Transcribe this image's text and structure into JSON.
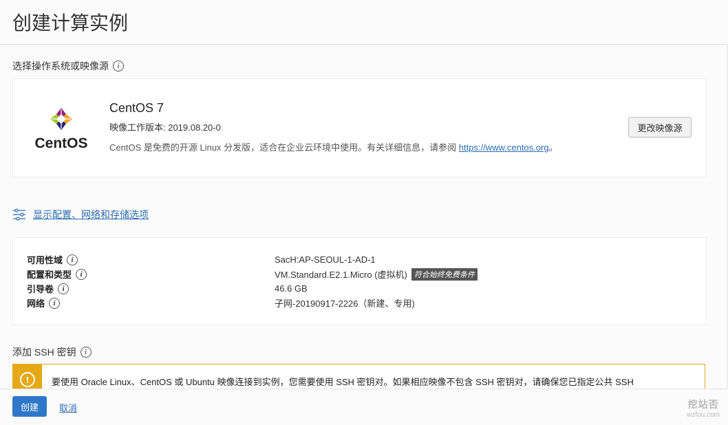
{
  "page": {
    "title": "创建计算实例"
  },
  "image_section": {
    "label": "选择操作系统或映像源",
    "info_glyph": "i",
    "os": {
      "logo_text": "CentOS",
      "name": "CentOS 7",
      "version_label": "映像工作版本: 2019.08.20-0",
      "description_prefix": "CentOS 是免费的开源 Linux 分发版，适合在企业云环境中使用。有关详细信息，请参阅 ",
      "link_text": "https://www.centos.org",
      "description_suffix": "。",
      "logo_colors": [
        "#9ccd2a",
        "#932279",
        "#efa724",
        "#262577"
      ]
    },
    "change_button": "更改映像源"
  },
  "advanced_link": "显示配置、网络和存储选项",
  "summary": {
    "rows": [
      {
        "key": "可用性域",
        "value": "SacH:AP-SEOUL-1-AD-1"
      },
      {
        "key": "配置和类型",
        "value": "VM.Standard.E2.1.Micro (虚拟机)",
        "badge": "符合始终免费条件"
      },
      {
        "key": "引导卷",
        "value": "46.6 GB"
      },
      {
        "key": "网络",
        "value": "子网-20190917-2226（新建、专用)"
      }
    ]
  },
  "ssh_section": {
    "label": "添加 SSH 密钥",
    "warning_glyph": "!",
    "warning_text": "要使用 Oracle Linux、CentOS 或 Ubuntu 映像连接到实例，您需要使用 SSH 密钥对。如果相应映像不包含 SSH 密钥对，请确保您已指定公共 SSH"
  },
  "footer": {
    "create_button": "创建",
    "cancel_link": "取消",
    "watermark_main": "挖站否",
    "watermark_sub": "wzfou.com"
  },
  "colors": {
    "primary": "#2f78c9",
    "warning": "#e4a915",
    "link": "#2b6cb0"
  }
}
